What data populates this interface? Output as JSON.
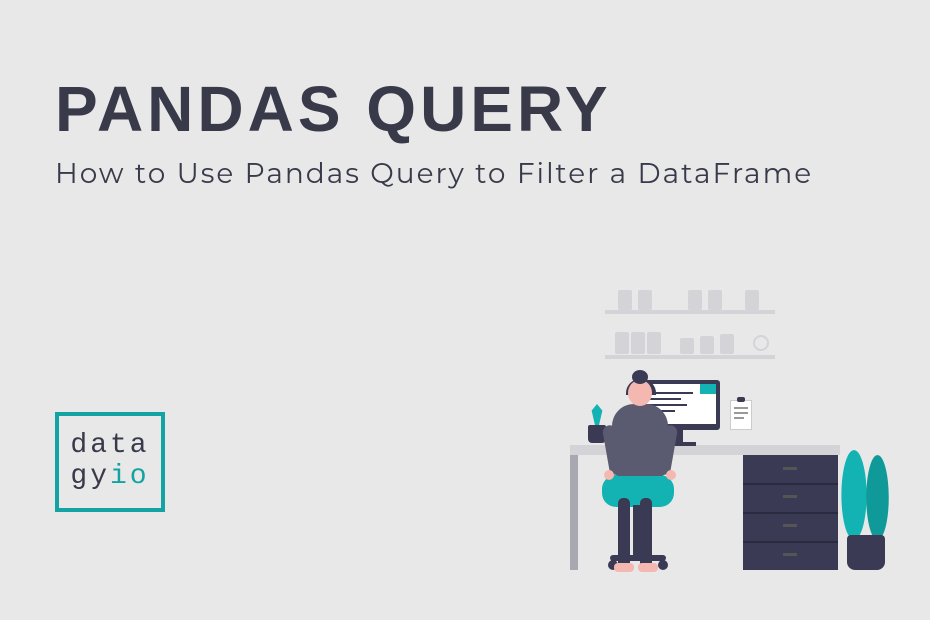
{
  "title": "PANDAS QUERY",
  "subtitle": "How to Use Pandas Query to Filter a DataFrame",
  "logo": {
    "line1": "data",
    "line2a": "gy",
    "line2b": "io"
  },
  "colors": {
    "accent": "#14a3a3",
    "dark": "#383a4a",
    "bg": "#e8e8e8"
  }
}
